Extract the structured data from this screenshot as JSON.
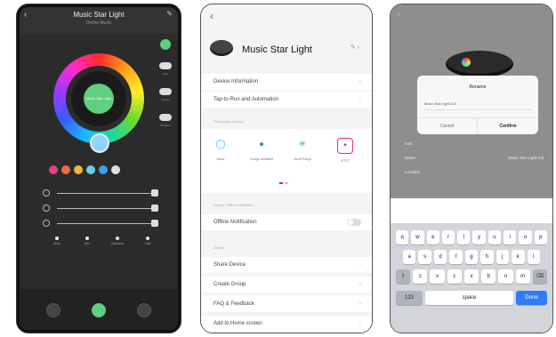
{
  "phone1": {
    "title": "Music Star Light",
    "subtitle": "Online Music",
    "center_label": "Music Star Light",
    "side_toggle_labels": [
      "",
      "Auto",
      "Rotate",
      "Random"
    ],
    "mode_labels": [
      "Slow",
      "Mix",
      "Classical",
      "Fast"
    ],
    "color_presets": [
      "#e0418a",
      "#f06a3a",
      "#f0b43a",
      "#6ad0e0",
      "#3aa0f0",
      "#e0e0e0"
    ],
    "accent_color": "#5fcf80"
  },
  "phone2": {
    "device_name": "Music Star Light",
    "rows_top": [
      "Device Information",
      "Tap-to-Run and Automation"
    ],
    "section_assistants": "Third-party Control",
    "assistants": [
      {
        "label": "Alexa",
        "icon": "alexa-icon"
      },
      {
        "label": "Google Assistant",
        "icon": "google-assistant-icon"
      },
      {
        "label": "SmartThings",
        "icon": "smartthings-icon"
      },
      {
        "label": "IFTTT",
        "icon": "ifttt-icon"
      }
    ],
    "section_offline": "Device Offline Notification",
    "offline_label": "Offline Notification",
    "section_others": "Others",
    "rows_bottom": [
      "Share Device",
      "Create Group",
      "FAQ & Feedback",
      "Add to Home screen"
    ]
  },
  "phone3": {
    "dialog_title": "Rename",
    "dialog_input": "Music Star Light-3.8",
    "cancel_label": "Cancel",
    "confirm_label": "Confirm",
    "rows": [
      {
        "label": "Icon",
        "value": ""
      },
      {
        "label": "Name",
        "value": "Music Star Light-3.8"
      },
      {
        "label": "Location",
        "value": ""
      }
    ],
    "keyboard": {
      "row1": [
        "q",
        "w",
        "e",
        "r",
        "t",
        "y",
        "u",
        "i",
        "o",
        "p"
      ],
      "row2": [
        "a",
        "s",
        "d",
        "f",
        "g",
        "h",
        "j",
        "k",
        "l"
      ],
      "row3": [
        "⇧",
        "z",
        "x",
        "c",
        "v",
        "b",
        "n",
        "m",
        "⌫"
      ],
      "row4": [
        "123",
        "space",
        "Done"
      ]
    }
  }
}
